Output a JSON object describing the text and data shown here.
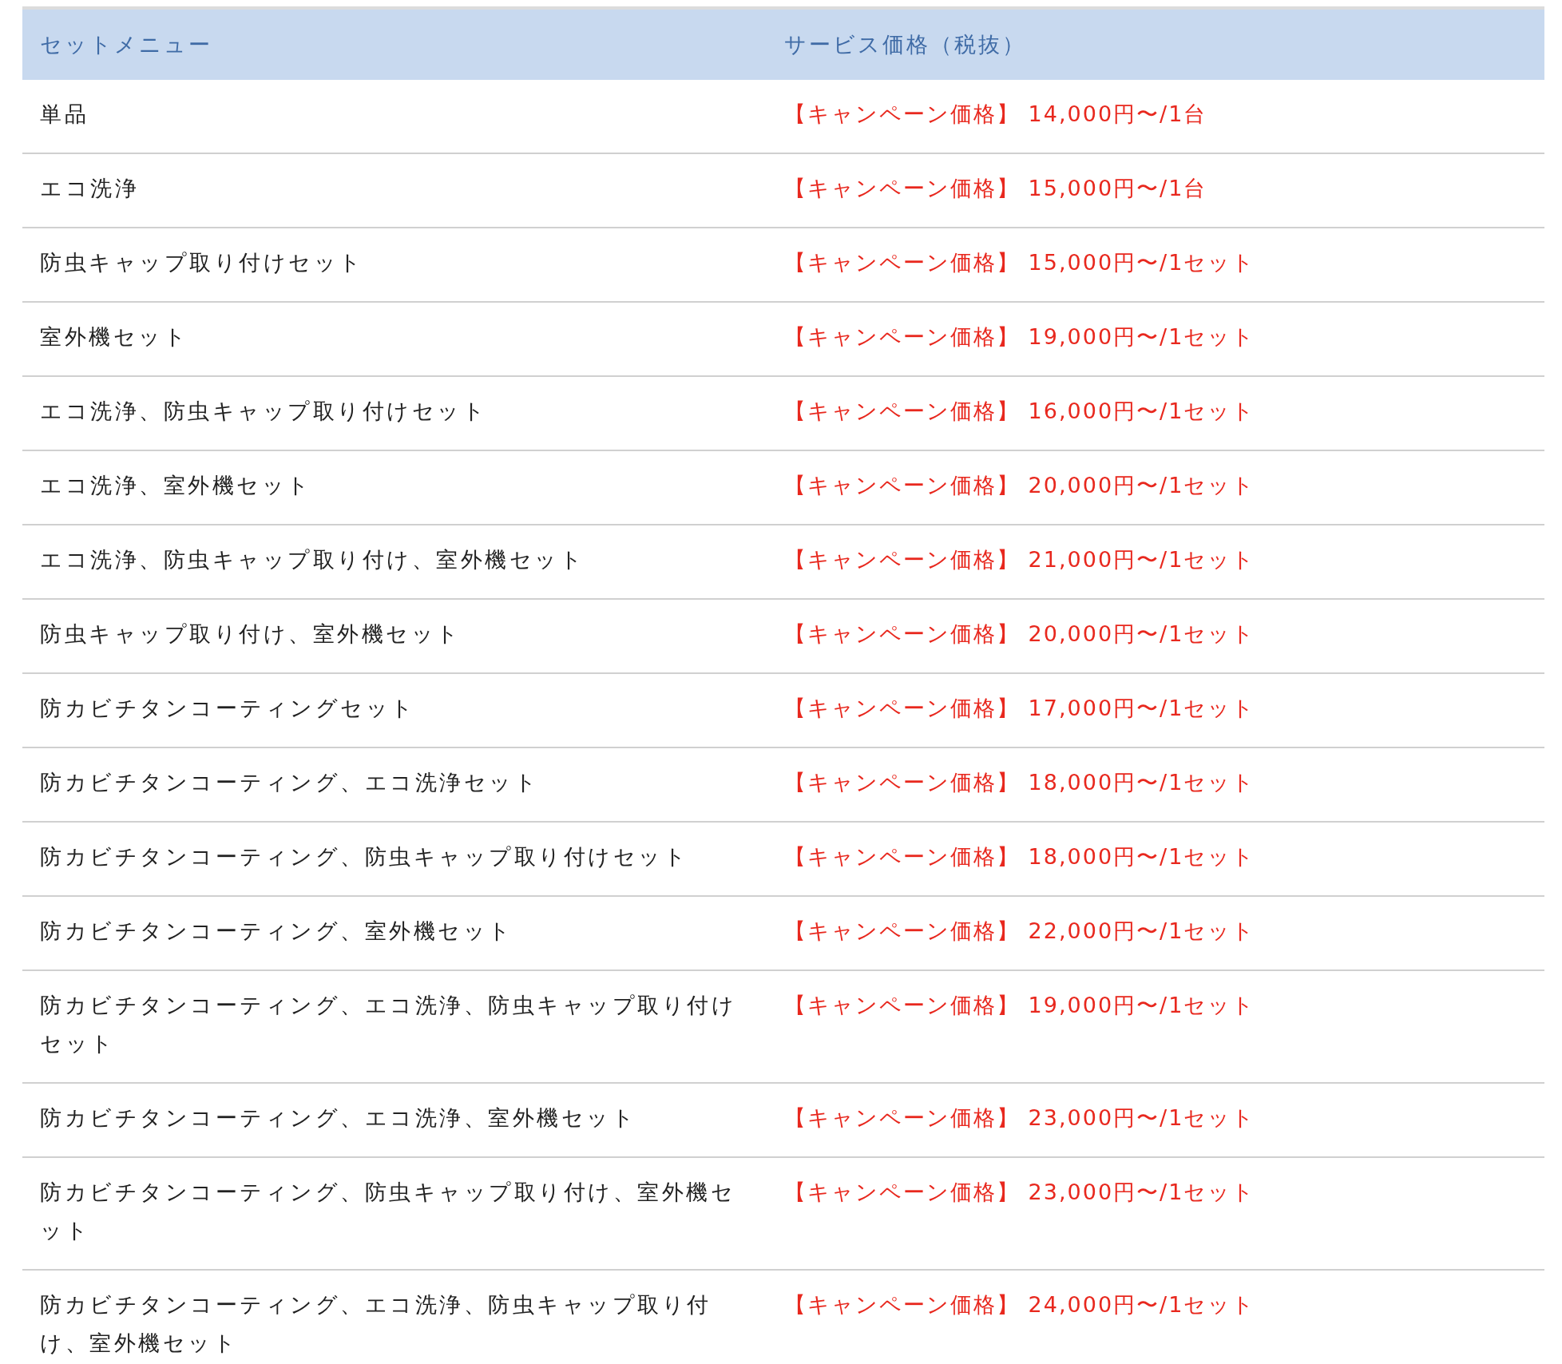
{
  "table": {
    "columns": [
      "セットメニュー",
      "サービス価格（税抜）"
    ],
    "rows": [
      {
        "menu": "単品",
        "price": "【キャンペーン価格】 14,000円〜/1台"
      },
      {
        "menu": "エコ洗浄",
        "price": "【キャンペーン価格】 15,000円〜/1台"
      },
      {
        "menu": "防虫キャップ取り付けセット",
        "price": "【キャンペーン価格】 15,000円〜/1セット"
      },
      {
        "menu": "室外機セット",
        "price": "【キャンペーン価格】 19,000円〜/1セット"
      },
      {
        "menu": "エコ洗浄、防虫キャップ取り付けセット",
        "price": "【キャンペーン価格】 16,000円〜/1セット"
      },
      {
        "menu": "エコ洗浄、室外機セット",
        "price": "【キャンペーン価格】 20,000円〜/1セット"
      },
      {
        "menu": "エコ洗浄、防虫キャップ取り付け、室外機セット",
        "price": "【キャンペーン価格】 21,000円〜/1セット"
      },
      {
        "menu": "防虫キャップ取り付け、室外機セット",
        "price": "【キャンペーン価格】 20,000円〜/1セット"
      },
      {
        "menu": "防カビチタンコーティングセット",
        "price": "【キャンペーン価格】 17,000円〜/1セット"
      },
      {
        "menu": "防カビチタンコーティング、エコ洗浄セット",
        "price": "【キャンペーン価格】 18,000円〜/1セット"
      },
      {
        "menu": "防カビチタンコーティング、防虫キャップ取り付けセット",
        "price": "【キャンペーン価格】 18,000円〜/1セット"
      },
      {
        "menu": "防カビチタンコーティング、室外機セット",
        "price": "【キャンペーン価格】 22,000円〜/1セット"
      },
      {
        "menu": "防カビチタンコーティング、エコ洗浄、防虫キャップ取り付けセット",
        "price": "【キャンペーン価格】 19,000円〜/1セット"
      },
      {
        "menu": "防カビチタンコーティング、エコ洗浄、室外機セット",
        "price": "【キャンペーン価格】 23,000円〜/1セット"
      },
      {
        "menu": "防カビチタンコーティング、防虫キャップ取り付け、室外機セット",
        "price": "【キャンペーン価格】 23,000円〜/1セット"
      },
      {
        "menu": "防カビチタンコーティング、エコ洗浄、防虫キャップ取り付け、室外機セット",
        "price": "【キャンペーン価格】 24,000円〜/1セット"
      }
    ]
  }
}
